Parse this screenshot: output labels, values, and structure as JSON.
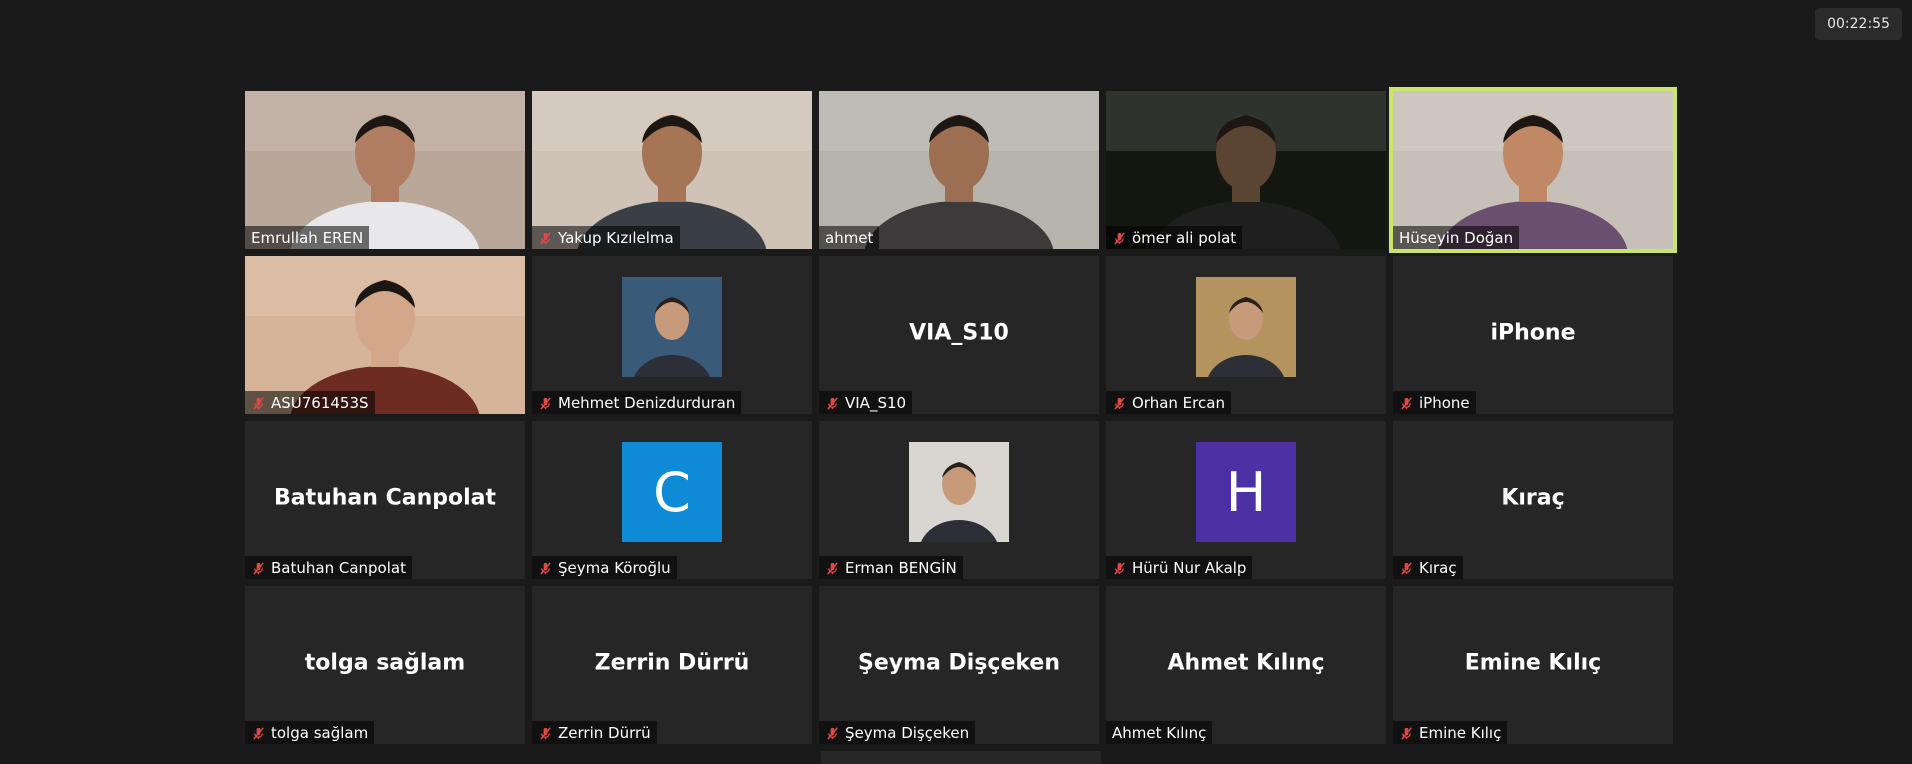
{
  "timer": "00:22:55",
  "accent_active": "#c9e56a",
  "tiles": [
    {
      "name": "Emrullah EREN",
      "muted": false,
      "kind": "video",
      "bg": "#b9a79a",
      "skin": "#b07c62",
      "shirt": "#e8e8ea"
    },
    {
      "name": "Yakup Kızılelma",
      "muted": true,
      "kind": "video",
      "bg": "#cfc3b8",
      "skin": "#a57555",
      "shirt": "#3a3f46"
    },
    {
      "name": "ahmet",
      "muted": false,
      "kind": "video",
      "bg": "#b7b3ad",
      "skin": "#9c6e52",
      "shirt": "#3c3a3a"
    },
    {
      "name": "ömer ali polat",
      "muted": true,
      "kind": "video",
      "bg": "#141610",
      "skin": "#5a4432",
      "shirt": "#1f1f1f"
    },
    {
      "name": "Hüseyin Doğan",
      "muted": false,
      "kind": "video",
      "bg": "#c7c0b8",
      "skin": "#c08864",
      "shirt": "#6b4f6e",
      "active": true
    },
    {
      "name": "ASU761453S",
      "muted": true,
      "kind": "video",
      "bg": "#d6b49a",
      "skin": "#d3a88a",
      "shirt": "#6e2b22"
    },
    {
      "name": "Mehmet Denizdurduran",
      "muted": true,
      "kind": "photo",
      "photo_bg": "#3a5a7a"
    },
    {
      "name": "VIA_S10",
      "muted": true,
      "kind": "text",
      "big": "VIA_S10"
    },
    {
      "name": "Orhan Ercan",
      "muted": true,
      "kind": "photo",
      "photo_bg": "#b4935f"
    },
    {
      "name": "iPhone",
      "muted": true,
      "kind": "text",
      "big": "iPhone"
    },
    {
      "name": "Batuhan Canpolat",
      "muted": true,
      "kind": "text",
      "big": "Batuhan Canpolat"
    },
    {
      "name": "Şeyma Köroğlu",
      "muted": true,
      "kind": "avatar",
      "letter": "C",
      "color": "#0e8ad6"
    },
    {
      "name": "Erman BENGİN",
      "muted": true,
      "kind": "photo",
      "photo_bg": "#d9d6d2"
    },
    {
      "name": "Hürü Nur Akalp",
      "muted": true,
      "kind": "avatar",
      "letter": "H",
      "color": "#4c31a4"
    },
    {
      "name": "Kıraç",
      "muted": true,
      "kind": "text",
      "big": "Kıraç"
    },
    {
      "name": "tolga sağlam",
      "muted": true,
      "kind": "text",
      "big": "tolga sağlam"
    },
    {
      "name": "Zerrin Dürrü",
      "muted": true,
      "kind": "text",
      "big": "Zerrin Dürrü"
    },
    {
      "name": "Şeyma Dişçeken",
      "muted": true,
      "kind": "text",
      "big": "Şeyma Dişçeken"
    },
    {
      "name": "Ahmet Kılınç",
      "muted": false,
      "kind": "text",
      "big": "Ahmet Kılınç"
    },
    {
      "name": "Emine Kılıç",
      "muted": true,
      "kind": "text",
      "big": "Emine Kılıç"
    }
  ]
}
